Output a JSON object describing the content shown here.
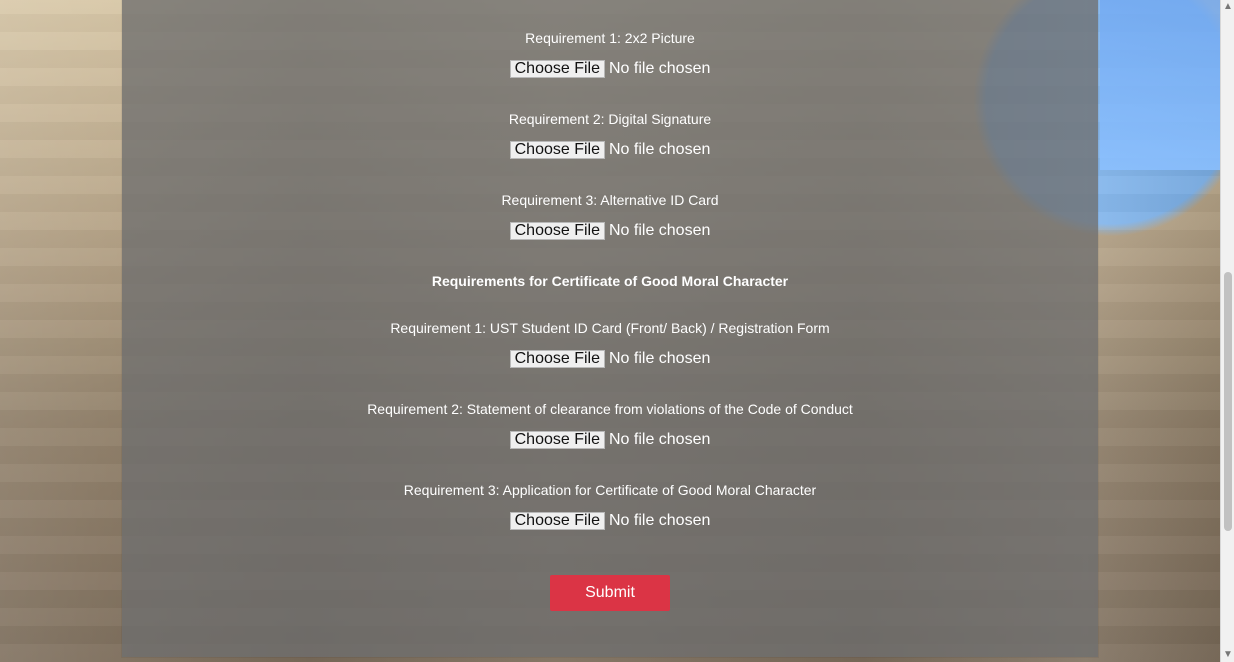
{
  "form": {
    "requirements_group_1": [
      {
        "label": "Requirement 1: 2x2 Picture",
        "button_label": "Choose File",
        "status": "No file chosen"
      },
      {
        "label": "Requirement 2: Digital Signature",
        "button_label": "Choose File",
        "status": "No file chosen"
      },
      {
        "label": "Requirement 3: Alternative ID Card",
        "button_label": "Choose File",
        "status": "No file chosen"
      }
    ],
    "section_title": "Requirements for Certificate of Good Moral Character",
    "requirements_group_2": [
      {
        "label": "Requirement 1: UST Student ID Card (Front/ Back) / Registration Form",
        "button_label": "Choose File",
        "status": "No file chosen"
      },
      {
        "label": "Requirement 2: Statement of clearance from violations of the Code of Conduct",
        "button_label": "Choose File",
        "status": "No file chosen"
      },
      {
        "label": "Requirement 3: Application for Certificate of Good Moral Character",
        "button_label": "Choose File",
        "status": "No file chosen"
      }
    ],
    "submit_label": "Submit"
  },
  "icons": {
    "scroll_up": "▲",
    "scroll_down": "▼"
  },
  "colors": {
    "panel": "#6e6e6e",
    "submit": "#db3445",
    "sky": "#7db3ec"
  }
}
